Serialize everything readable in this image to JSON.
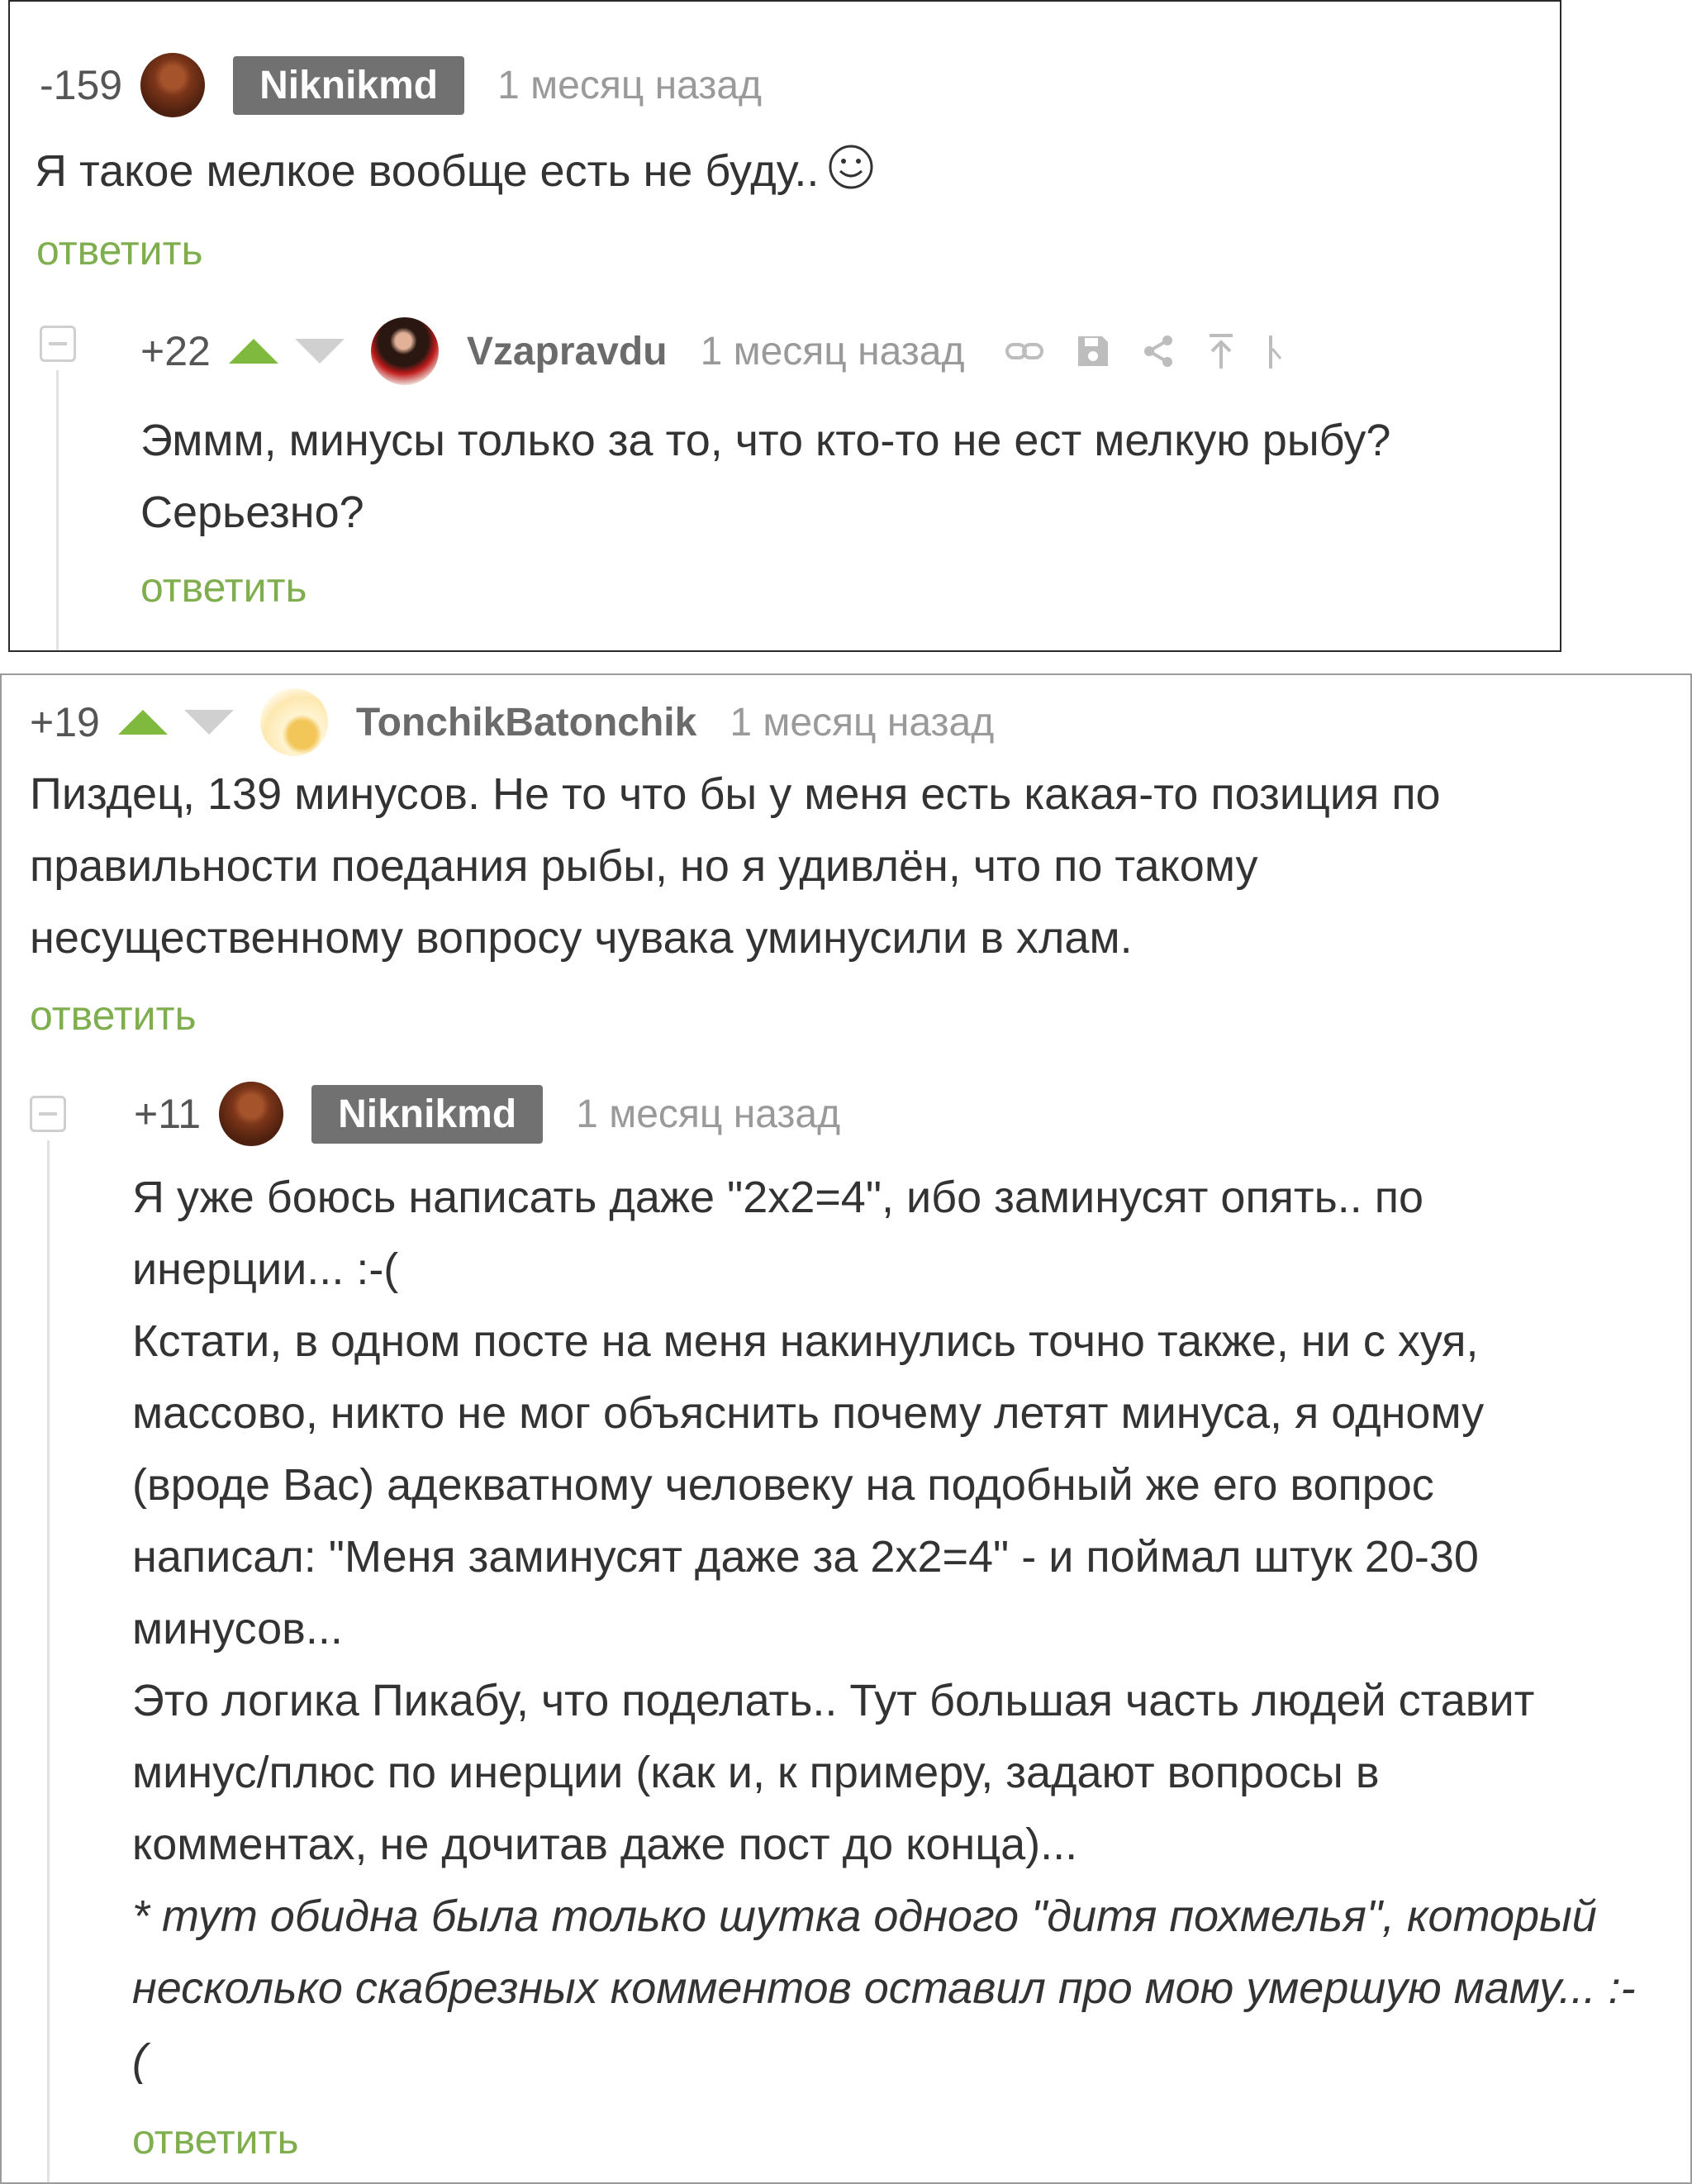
{
  "panel1": {
    "comment1": {
      "rating": "-159",
      "username": "Niknikmd",
      "time": "1 месяц назад",
      "text": "Я такое мелкое вообще есть не буду..",
      "reply_label": "ответить"
    },
    "comment2": {
      "rating": "+22",
      "username": "Vzapravdu",
      "time": "1 месяц назад",
      "text_lines": [
        "Эммм, минусы только за то, что кто-то не ест мелкую рыбу?",
        "Серьезно?"
      ],
      "reply_label": "ответить",
      "tools": [
        "link-icon",
        "save-icon",
        "share-icon",
        "scroll-up-icon",
        "more-icon"
      ]
    }
  },
  "panel2": {
    "comment3": {
      "rating": "+19",
      "username": "TonchikBatonchik",
      "time": "1 месяц назад",
      "text_lines": [
        "Пиздец, 139 минусов. Не то что бы у меня есть какая-то позиция по",
        "правильности поедания рыбы, но я удивлён, что по такому",
        "несущественному вопросу чувака уминусили в хлам."
      ],
      "reply_label": "ответить"
    },
    "comment4": {
      "rating": "+11",
      "username": "Niknikmd",
      "time": "1 месяц назад",
      "text_lines": [
        "Я уже боюсь написать даже \"2х2=4\", ибо заминусят опять.. по",
        "инерции... :-(",
        "Кстати, в одном посте на меня накинулись точно также, ни с хуя,",
        "массово, никто не мог объяснить почему летят минуса, я одному",
        "(вроде Вас) адекватному человеку на подобный же его вопрос",
        "написал: \"Меня заминусят даже за 2х2=4\" - и поймал штук 20-30",
        "минусов...",
        "Это логика Пикабу, что поделать.. Тут большая часть людей ставит",
        "минус/плюс по инерции (как и, к примеру, задают вопросы в",
        "комментах, не дочитав даже пост до конца)..."
      ],
      "italic_lines": [
        "* тут обидна была только шутка одного \"дитя похмелья\", который",
        "несколько скабрезных комментов оставил про мою умершую маму... :-",
        "("
      ],
      "reply_label": "ответить"
    }
  }
}
